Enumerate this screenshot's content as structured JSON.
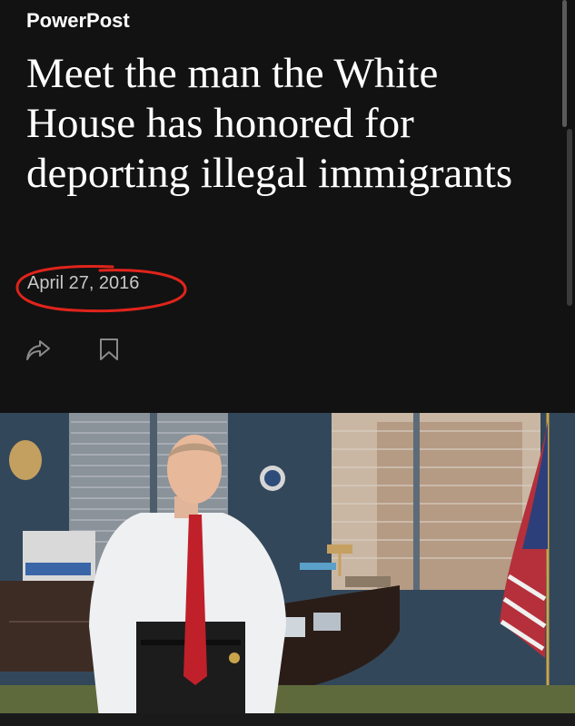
{
  "article": {
    "section": "PowerPost",
    "headline": "Meet the man the White House has honored for deporting illegal immigrants",
    "date": "April 27, 2016"
  },
  "actions": {
    "share_icon": "share-arrow-icon",
    "bookmark_icon": "bookmark-icon"
  },
  "colors": {
    "background": "#121212",
    "text": "#ffffff",
    "date": "#c8c8c8",
    "annotation": "#e0241b"
  }
}
